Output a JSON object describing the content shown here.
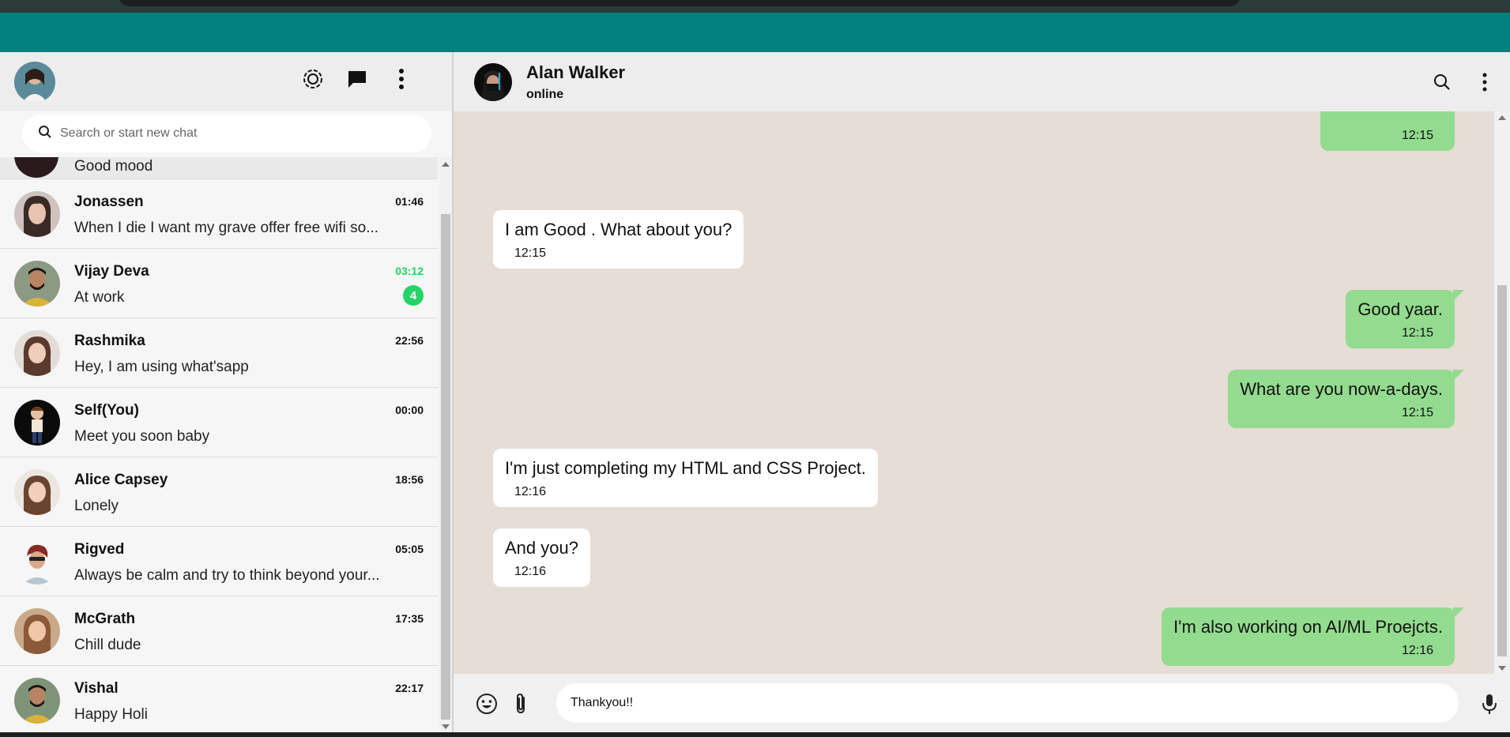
{
  "sidebar": {
    "search": {
      "placeholder": "Search or start new chat"
    },
    "partial_row": {
      "message": "Good mood"
    },
    "chats": [
      {
        "name": "Jonassen",
        "message": "When I die I want my grave offer free wifi so...",
        "time": "01:46",
        "unread": ""
      },
      {
        "name": "Vijay Deva",
        "message": "At work",
        "time": "03:12",
        "unread": "4"
      },
      {
        "name": "Rashmika",
        "message": "Hey, I am using what'sapp",
        "time": "22:56",
        "unread": ""
      },
      {
        "name": "Self(You)",
        "message": "Meet you soon baby",
        "time": "00:00",
        "unread": ""
      },
      {
        "name": "Alice Capsey",
        "message": "Lonely",
        "time": "18:56",
        "unread": ""
      },
      {
        "name": "Rigved",
        "message": "Always be calm and try to think beyond your...",
        "time": "05:05",
        "unread": ""
      },
      {
        "name": "McGrath",
        "message": "Chill dude",
        "time": "17:35",
        "unread": ""
      },
      {
        "name": "Vishal",
        "message": "Happy Holi",
        "time": "22:17",
        "unread": ""
      }
    ]
  },
  "conversation": {
    "contact_name": "Alan Walker",
    "contact_status": "online",
    "messages": [
      {
        "direction": "out",
        "text": "",
        "time": "12:15"
      },
      {
        "direction": "in",
        "text": "I am Good . What about you?",
        "time": "12:15"
      },
      {
        "direction": "out",
        "text": "Good yaar.",
        "time": "12:15"
      },
      {
        "direction": "out",
        "text": "What are you now-a-days.",
        "time": "12:15"
      },
      {
        "direction": "in",
        "text": "I'm just completing my HTML and CSS Project.",
        "time": "12:16"
      },
      {
        "direction": "in",
        "text": "And you?",
        "time": "12:16"
      },
      {
        "direction": "out",
        "text": "I'm also working on AI/ML Proejcts.",
        "time": "12:16"
      }
    ],
    "composer_value": "Thankyou!!"
  },
  "colors": {
    "teal": "#00807f",
    "outgoing_bubble": "#93db8e",
    "incoming_bubble": "#ffffff",
    "chat_background": "#e5ddd6",
    "unread_green": "#25d366"
  },
  "icons": {
    "status": "status-ring-icon",
    "new_chat": "chat-bubble-icon",
    "menu": "kebab-menu-icon",
    "search": "search-icon",
    "emoji": "emoji-icon",
    "attach": "paperclip-icon",
    "mic": "microphone-icon"
  }
}
